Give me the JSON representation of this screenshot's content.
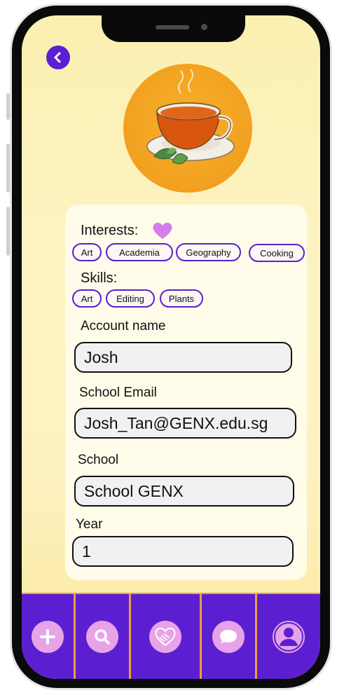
{
  "interests": {
    "label": "Interests:",
    "chips": [
      "Art",
      "Academia",
      "Geography",
      "Cooking"
    ]
  },
  "skills": {
    "label": "Skills:",
    "chips": [
      "Art",
      "Editing",
      "Plants"
    ]
  },
  "form": {
    "account_name": {
      "label": "Account name",
      "value": "Josh"
    },
    "school_email": {
      "label": "School Email",
      "value": "Josh_Tan@GENX.edu.sg"
    },
    "school": {
      "label": "School",
      "value": "School GENX"
    },
    "year": {
      "label": "Year",
      "value": "1"
    }
  },
  "colors": {
    "accent": "#5b1fd1",
    "nav_icon": "#e7a3e8",
    "nav_divider": "#ef9d3a",
    "avatar_bg": "#f2a01f",
    "heart": "#d57ee8"
  },
  "icons": {
    "back": "chevron-left-icon",
    "heart": "heart-icon",
    "nav": [
      "plus-icon",
      "search-icon",
      "handshake-icon",
      "chat-bubble-icon",
      "user-profile-icon"
    ]
  }
}
